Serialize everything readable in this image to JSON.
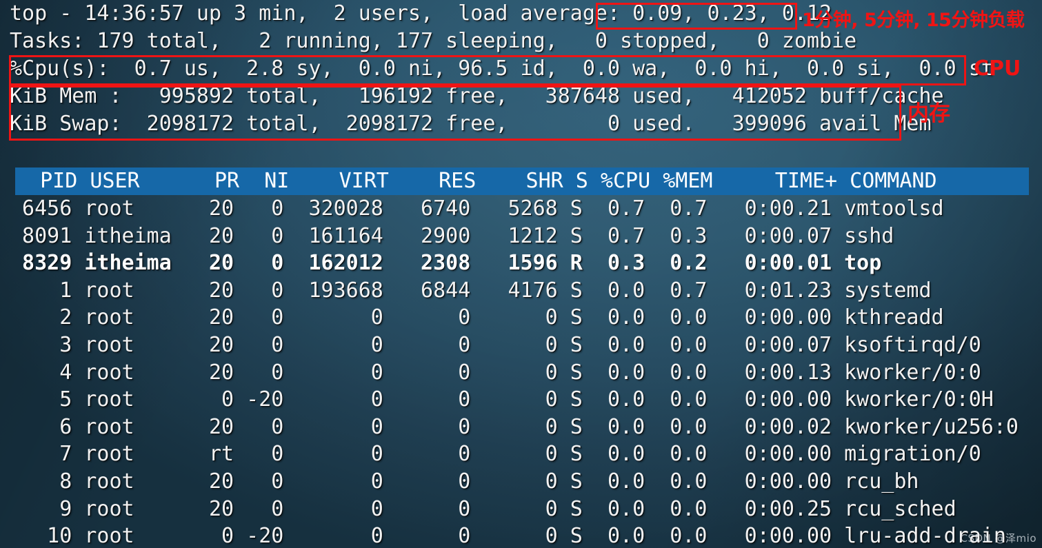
{
  "summary": {
    "uptime_line": "top - 14:36:57 up 3 min,  2 users,  load average: 0.09, 0.23, 0.12",
    "uptime_prefix": "top - 14:36:57 up 3 min,  2 users,  load average: ",
    "load_average": "0.09, 0.23, 0.12",
    "tasks_line": "Tasks: 179 total,   2 running, 177 sleeping,   0 stopped,   0 zombie",
    "cpu_line": "%Cpu(s):  0.7 us,  2.8 sy,  0.0 ni, 96.5 id,  0.0 wa,  0.0 hi,  0.0 si,  0.0 st",
    "mem_line": "KiB Mem :   995892 total,   196192 free,   387648 used,   412052 buff/cache",
    "swap_line": "KiB Swap:  2098172 total,  2098172 free,        0 used.   399096 avail Mem",
    "fields": {
      "time": "14:36:57",
      "uptime": "3 min",
      "users": "2",
      "load_1min": "0.09",
      "load_5min": "0.23",
      "load_15min": "0.12",
      "tasks_total": "179",
      "tasks_running": "2",
      "tasks_sleeping": "177",
      "tasks_stopped": "0",
      "tasks_zombie": "0",
      "cpu_us": "0.7",
      "cpu_sy": "2.8",
      "cpu_ni": "0.0",
      "cpu_id": "96.5",
      "cpu_wa": "0.0",
      "cpu_hi": "0.0",
      "cpu_si": "0.0",
      "cpu_st": "0.0",
      "mem_total": "995892",
      "mem_free": "196192",
      "mem_used": "387648",
      "mem_buff_cache": "412052",
      "swap_total": "2098172",
      "swap_free": "2098172",
      "swap_used": "0",
      "avail_mem": "399096"
    }
  },
  "annotations": {
    "load": "1分钟, 5分钟, 15分钟负载",
    "cpu": "CPU",
    "memory": "内存",
    "color": "#f01414"
  },
  "table": {
    "header": "  PID USER      PR  NI    VIRT    RES    SHR S %CPU %MEM     TIME+ COMMAND",
    "header_bg": "#1668a8",
    "columns": [
      "PID",
      "USER",
      "PR",
      "NI",
      "VIRT",
      "RES",
      "SHR",
      "S",
      "%CPU",
      "%MEM",
      "TIME+",
      "COMMAND"
    ],
    "rows": [
      {
        "text": " 6456 root      20   0  320028   6740   5268 S  0.7  0.7   0:00.21 vmtoolsd",
        "bold": false,
        "pid": "6456",
        "user": "root",
        "pr": "20",
        "ni": "0",
        "virt": "320028",
        "res": "6740",
        "shr": "5268",
        "s": "S",
        "cpu": "0.7",
        "mem": "0.7",
        "time": "0:00.21",
        "command": "vmtoolsd"
      },
      {
        "text": " 8091 itheima   20   0  161164   2900   1212 S  0.7  0.3   0:00.07 sshd",
        "bold": false,
        "pid": "8091",
        "user": "itheima",
        "pr": "20",
        "ni": "0",
        "virt": "161164",
        "res": "2900",
        "shr": "1212",
        "s": "S",
        "cpu": "0.7",
        "mem": "0.3",
        "time": "0:00.07",
        "command": "sshd"
      },
      {
        "text": " 8329 itheima   20   0  162012   2308   1596 R  0.3  0.2   0:00.01 top",
        "bold": true,
        "pid": "8329",
        "user": "itheima",
        "pr": "20",
        "ni": "0",
        "virt": "162012",
        "res": "2308",
        "shr": "1596",
        "s": "R",
        "cpu": "0.3",
        "mem": "0.2",
        "time": "0:00.01",
        "command": "top"
      },
      {
        "text": "    1 root      20   0  193668   6844   4176 S  0.0  0.7   0:01.23 systemd",
        "bold": false,
        "pid": "1",
        "user": "root",
        "pr": "20",
        "ni": "0",
        "virt": "193668",
        "res": "6844",
        "shr": "4176",
        "s": "S",
        "cpu": "0.0",
        "mem": "0.7",
        "time": "0:01.23",
        "command": "systemd"
      },
      {
        "text": "    2 root      20   0       0      0      0 S  0.0  0.0   0:00.00 kthreadd",
        "bold": false,
        "pid": "2",
        "user": "root",
        "pr": "20",
        "ni": "0",
        "virt": "0",
        "res": "0",
        "shr": "0",
        "s": "S",
        "cpu": "0.0",
        "mem": "0.0",
        "time": "0:00.00",
        "command": "kthreadd"
      },
      {
        "text": "    3 root      20   0       0      0      0 S  0.0  0.0   0:00.07 ksoftirqd/0",
        "bold": false,
        "pid": "3",
        "user": "root",
        "pr": "20",
        "ni": "0",
        "virt": "0",
        "res": "0",
        "shr": "0",
        "s": "S",
        "cpu": "0.0",
        "mem": "0.0",
        "time": "0:00.07",
        "command": "ksoftirqd/0"
      },
      {
        "text": "    4 root      20   0       0      0      0 S  0.0  0.0   0:00.13 kworker/0:0",
        "bold": false,
        "pid": "4",
        "user": "root",
        "pr": "20",
        "ni": "0",
        "virt": "0",
        "res": "0",
        "shr": "0",
        "s": "S",
        "cpu": "0.0",
        "mem": "0.0",
        "time": "0:00.13",
        "command": "kworker/0:0"
      },
      {
        "text": "    5 root       0 -20       0      0      0 S  0.0  0.0   0:00.00 kworker/0:0H",
        "bold": false,
        "pid": "5",
        "user": "root",
        "pr": "0",
        "ni": "-20",
        "virt": "0",
        "res": "0",
        "shr": "0",
        "s": "S",
        "cpu": "0.0",
        "mem": "0.0",
        "time": "0:00.00",
        "command": "kworker/0:0H"
      },
      {
        "text": "    6 root      20   0       0      0      0 S  0.0  0.0   0:00.02 kworker/u256:0",
        "bold": false,
        "pid": "6",
        "user": "root",
        "pr": "20",
        "ni": "0",
        "virt": "0",
        "res": "0",
        "shr": "0",
        "s": "S",
        "cpu": "0.0",
        "mem": "0.0",
        "time": "0:00.02",
        "command": "kworker/u256:0"
      },
      {
        "text": "    7 root      rt   0       0      0      0 S  0.0  0.0   0:00.00 migration/0",
        "bold": false,
        "pid": "7",
        "user": "root",
        "pr": "rt",
        "ni": "0",
        "virt": "0",
        "res": "0",
        "shr": "0",
        "s": "S",
        "cpu": "0.0",
        "mem": "0.0",
        "time": "0:00.00",
        "command": "migration/0"
      },
      {
        "text": "    8 root      20   0       0      0      0 S  0.0  0.0   0:00.00 rcu_bh",
        "bold": false,
        "pid": "8",
        "user": "root",
        "pr": "20",
        "ni": "0",
        "virt": "0",
        "res": "0",
        "shr": "0",
        "s": "S",
        "cpu": "0.0",
        "mem": "0.0",
        "time": "0:00.00",
        "command": "rcu_bh"
      },
      {
        "text": "    9 root      20   0       0      0      0 S  0.0  0.0   0:00.25 rcu_sched",
        "bold": false,
        "pid": "9",
        "user": "root",
        "pr": "20",
        "ni": "0",
        "virt": "0",
        "res": "0",
        "shr": "0",
        "s": "S",
        "cpu": "0.0",
        "mem": "0.0",
        "time": "0:00.25",
        "command": "rcu_sched"
      },
      {
        "text": "   10 root       0 -20       0      0      0 S  0.0  0.0   0:00.00 lru-add-drain",
        "bold": false,
        "pid": "10",
        "user": "root",
        "pr": "0",
        "ni": "-20",
        "virt": "0",
        "res": "0",
        "shr": "0",
        "s": "S",
        "cpu": "0.0",
        "mem": "0.0",
        "time": "0:00.00",
        "command": "lru-add-drain"
      }
    ]
  },
  "watermark": "CSDN @泽mio"
}
